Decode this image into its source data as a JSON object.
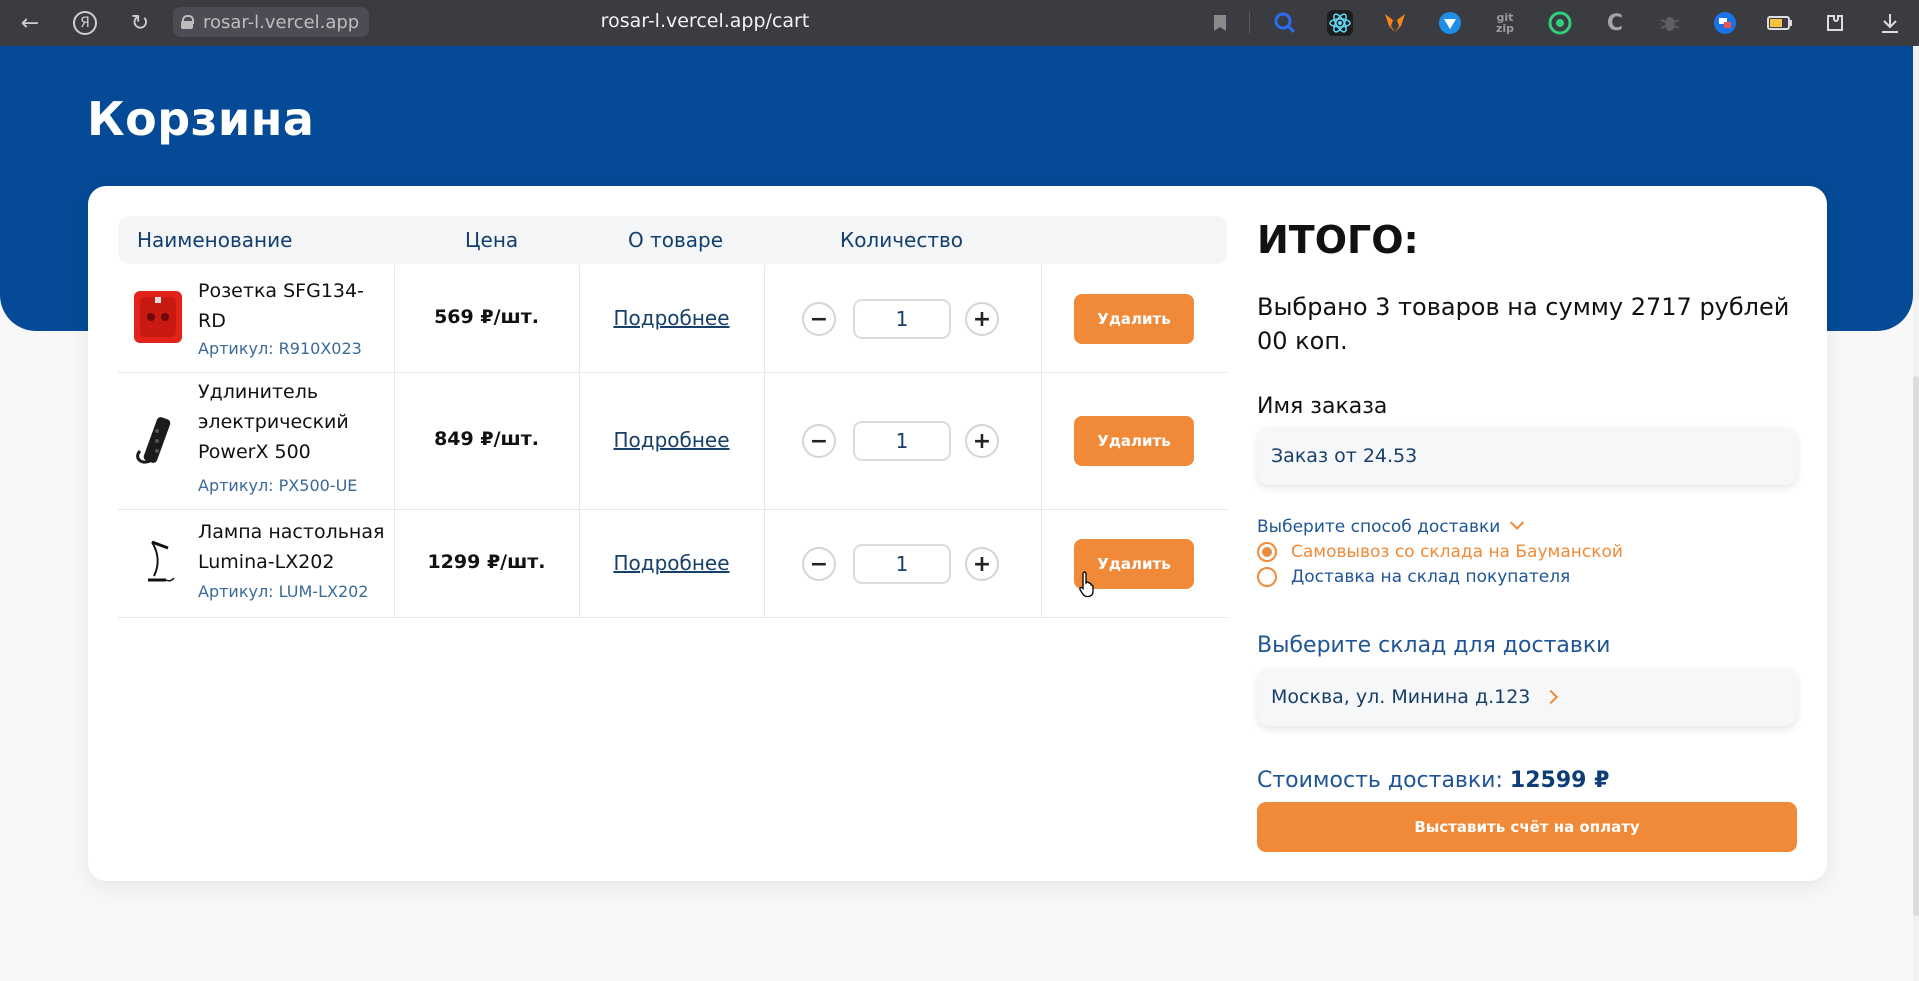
{
  "browser": {
    "domain_chip": "rosar-l.vercel.app",
    "url": "rosar-l.vercel.app/cart",
    "back_glyph": "←",
    "yandex_glyph": "Я",
    "reload_glyph": "↻",
    "extensions": [
      "bookmark-icon",
      "search-icon",
      "react-icon",
      "metamask-icon",
      "vpn-icon",
      "gitzip-icon",
      "circle-ext-icon",
      "cookie-ext-icon",
      "bug-ext-icon",
      "translate-icon",
      "battery-icon",
      "extensions-icon",
      "download-icon"
    ]
  },
  "page": {
    "title": "Корзина"
  },
  "table": {
    "headers": {
      "name": "Наименование",
      "price": "Цена",
      "about": "О товаре",
      "qty": "Количество"
    },
    "rows": [
      {
        "name": "Розетка SFG134-RD",
        "sku": "Артикул: R910X023",
        "price": "569 ₽/шт.",
        "more": "Подробнее",
        "qty": "1",
        "minus": "−",
        "plus": "+",
        "delete": "Удалить",
        "image": "red-socket"
      },
      {
        "name": "Удлинитель электрический PowerX 500",
        "sku": "Артикул: PX500-UE",
        "price": "849 ₽/шт.",
        "more": "Подробнее",
        "qty": "1",
        "minus": "−",
        "plus": "+",
        "delete": "Удалить",
        "image": "power-strip"
      },
      {
        "name": "Лампа настольная Lumina-LX202",
        "sku": "Артикул: LUM-LX202",
        "price": "1299 ₽/шт.",
        "more": "Подробнее",
        "qty": "1",
        "minus": "−",
        "plus": "+",
        "delete": "Удалить",
        "image": "desk-lamp"
      }
    ]
  },
  "summary": {
    "title": "ИТОГО:",
    "text": "Выбрано 3 товаров на сумму 2717 рублей 00 коп.",
    "order_name_label": "Имя заказа",
    "order_name_value": "Заказ от 24.53",
    "delivery_select_label": "Выберите способ доставки",
    "delivery_options": [
      {
        "label": "Самовывоз со склада на Бауманской",
        "selected": true
      },
      {
        "label": "Доставка на склад покупателя",
        "selected": false
      }
    ],
    "warehouse_label": "Выберите склад для доставки",
    "warehouse_value": "Москва, ул. Минина д.123",
    "delivery_cost_label": "Стоимость доставки:",
    "delivery_cost_value": "12599 ₽",
    "invoice_button": "Выставить счёт на оплату"
  },
  "colors": {
    "brand_blue": "#044a96",
    "accent_orange": "#f08a38",
    "text_blue": "#163f6a"
  }
}
